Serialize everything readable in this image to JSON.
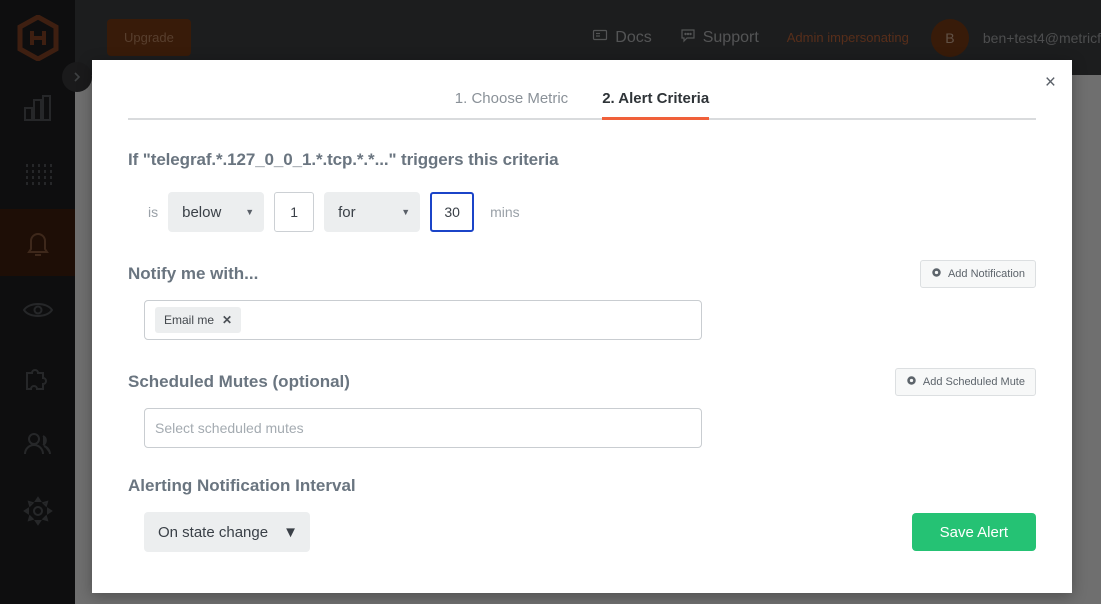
{
  "app": {
    "sidebar": {
      "logo": "hexagon-logo",
      "items": [
        {
          "icon": "bar-chart-icon",
          "name": "dashboards",
          "active": false
        },
        {
          "icon": "metrics-sliders-icon",
          "name": "metrics",
          "active": false
        },
        {
          "icon": "bell-icon",
          "name": "alerts",
          "active": true
        },
        {
          "icon": "eye-icon",
          "name": "monitors",
          "active": false
        },
        {
          "icon": "puzzle-icon",
          "name": "integrations",
          "active": false
        },
        {
          "icon": "users-icon",
          "name": "team",
          "active": false
        },
        {
          "icon": "gear-icon",
          "name": "settings",
          "active": false
        }
      ],
      "collapse_icon": "chevron-right-icon"
    },
    "topbar": {
      "upgrade_label": "Upgrade",
      "docs_label": "Docs",
      "docs_icon": "book-icon",
      "support_label": "Support",
      "support_icon": "chat-bubble-icon",
      "impersonating_label": "Admin impersonating",
      "avatar_initial": "B",
      "user_email": "ben+test4@metricf"
    }
  },
  "modal": {
    "close_label": "×",
    "tabs": [
      {
        "label": "1. Choose Metric",
        "active": false
      },
      {
        "label": "2. Alert Criteria",
        "active": true
      }
    ],
    "criteria": {
      "title": "If \"telegraf.*.127_0_0_1.*.tcp.*.*...\" triggers this criteria",
      "is_label": "is",
      "comparator": "below",
      "threshold_value": "1",
      "for_label": "for",
      "duration_value": "30",
      "mins_label": "mins"
    },
    "notify": {
      "title": "Notify me with...",
      "add_button_label": "Add Notification",
      "add_button_icon": "gear-icon",
      "tokens": [
        {
          "label": "Email me",
          "remove_icon": "close-icon"
        }
      ]
    },
    "mutes": {
      "title": "Scheduled Mutes (optional)",
      "add_button_label": "Add Scheduled Mute",
      "add_button_icon": "gear-icon",
      "placeholder": "Select scheduled mutes"
    },
    "interval": {
      "title": "Alerting Notification Interval",
      "selected": "On state change"
    },
    "save_label": "Save Alert"
  },
  "colors": {
    "accent_orange": "#f0603a",
    "save_green": "#25c274",
    "focus_blue": "#1b44c8",
    "sidebar_active": "#43200f"
  }
}
